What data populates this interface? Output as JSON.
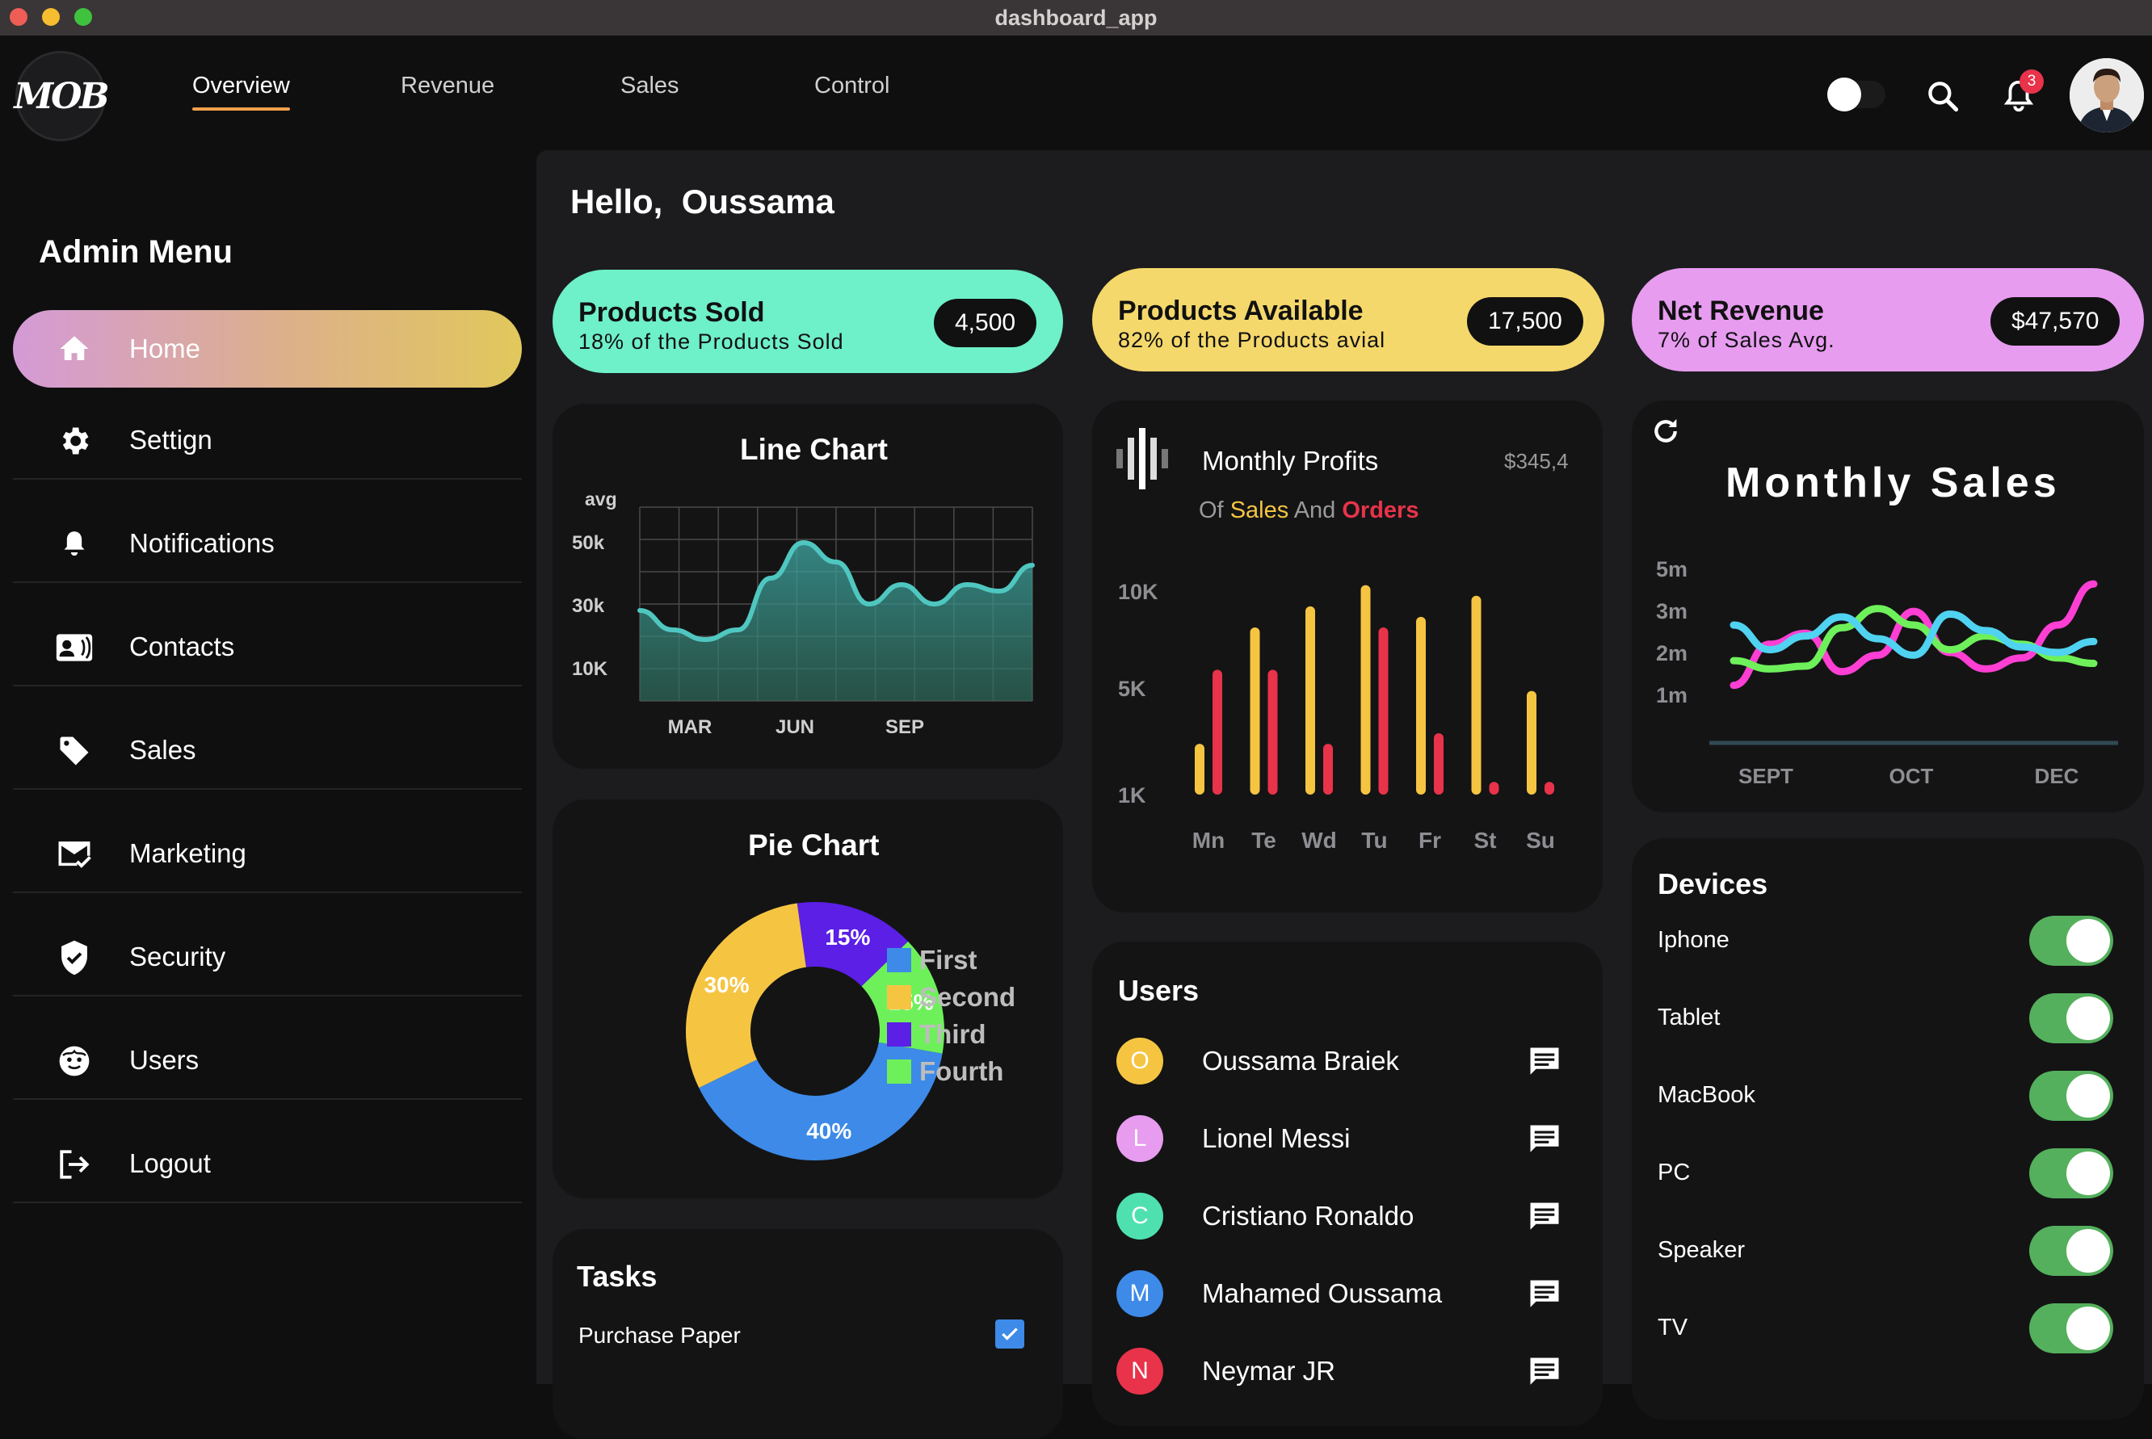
{
  "window": {
    "title": "dashboard_app"
  },
  "brand": {
    "logo_text": "MOB"
  },
  "nav": {
    "tabs": [
      "Overview",
      "Revenue",
      "Sales",
      "Control"
    ],
    "notifications_count": "3"
  },
  "sidebar": {
    "title": "Admin Menu",
    "items": [
      {
        "label": "Home",
        "icon": "home-icon"
      },
      {
        "label": "Settign",
        "icon": "gear-icon"
      },
      {
        "label": "Notifications",
        "icon": "bell-icon"
      },
      {
        "label": "Contacts",
        "icon": "contact-card-icon"
      },
      {
        "label": "Sales",
        "icon": "tag-icon"
      },
      {
        "label": "Marketing",
        "icon": "mail-check-icon"
      },
      {
        "label": "Security",
        "icon": "shield-icon"
      },
      {
        "label": "Users",
        "icon": "face-icon"
      },
      {
        "label": "Logout",
        "icon": "logout-icon"
      }
    ]
  },
  "greeting": {
    "hello": "Hello,",
    "name": "Oussama"
  },
  "stats": [
    {
      "title": "Products Sold",
      "subtitle": "18% of the Products Sold",
      "value": "4,500",
      "color": "#6ef0c8"
    },
    {
      "title": "Products Available",
      "subtitle": "82% of the Products avial",
      "value": "17,500",
      "color": "#f5d86b"
    },
    {
      "title": "Net Revenue",
      "subtitle": "7% of Sales Avg.",
      "value": "$47,570",
      "color": "#e79cf0"
    }
  ],
  "line_chart": {
    "title": "Line Chart"
  },
  "pie_chart": {
    "title": "Pie Chart"
  },
  "profits": {
    "title": "Monthly Profits",
    "amount": "$345,4",
    "subtitle_prefix": "Of",
    "subtitle_sales": "Sales",
    "subtitle_and": "And",
    "subtitle_orders": "Orders"
  },
  "monthly_sales": {
    "title": "Monthly Sales"
  },
  "tasks": {
    "title": "Tasks",
    "items": [
      {
        "label": "Purchase Paper",
        "checked": true
      }
    ]
  },
  "users": {
    "title": "Users",
    "items": [
      {
        "initial": "O",
        "name": "Oussama Braiek",
        "color": "#f5c542"
      },
      {
        "initial": "L",
        "name": "Lionel Messi",
        "color": "#e79cf0"
      },
      {
        "initial": "C",
        "name": "Cristiano Ronaldo",
        "color": "#4fe0b0"
      },
      {
        "initial": "M",
        "name": "Mahamed Oussama",
        "color": "#3d8ae8"
      },
      {
        "initial": "N",
        "name": "Neymar JR",
        "color": "#e8334a"
      }
    ]
  },
  "devices": {
    "title": "Devices",
    "items": [
      {
        "name": "Iphone",
        "on": true
      },
      {
        "name": "Tablet",
        "on": true
      },
      {
        "name": "MacBook",
        "on": true
      },
      {
        "name": "PC",
        "on": true
      },
      {
        "name": "Speaker",
        "on": true
      },
      {
        "name": "TV",
        "on": true
      }
    ]
  },
  "chart_data": [
    {
      "type": "area",
      "title": "Line Chart",
      "ylabel": "avg",
      "yticks": [
        "50k",
        "30k",
        "10K"
      ],
      "xticks": [
        "MAR",
        "JUN",
        "SEP"
      ],
      "x": [
        1,
        2,
        3,
        4,
        5,
        6,
        7,
        8,
        9,
        10,
        11,
        12,
        13
      ],
      "values": [
        28,
        22,
        19,
        22,
        38,
        49,
        43,
        30,
        36,
        30,
        36,
        34,
        42
      ],
      "ylim": [
        0,
        60
      ],
      "grid": true,
      "color": "#4fc7c0"
    },
    {
      "type": "pie",
      "title": "Pie Chart",
      "categories": [
        "First",
        "Second",
        "Third",
        "Fourth"
      ],
      "values": [
        40,
        30,
        15,
        15
      ],
      "labels": [
        "40%",
        "30%",
        "15%",
        "15%"
      ],
      "colors": [
        "#3d8ae8",
        "#f5c542",
        "#5b1fe6",
        "#6ef05a"
      ]
    },
    {
      "type": "bar",
      "title": "Monthly Profits",
      "categories": [
        "Mn",
        "Te",
        "Wd",
        "Tu",
        "Fr",
        "St",
        "Su"
      ],
      "yticks": [
        "10K",
        "5K",
        "1K"
      ],
      "series": [
        {
          "name": "Sales",
          "color": "#f5c542",
          "values": [
            2.4,
            7.9,
            8.9,
            9.9,
            8.4,
            9.4,
            4.9
          ]
        },
        {
          "name": "Orders",
          "color": "#e8334a",
          "values": [
            5.9,
            5.9,
            2.4,
            7.9,
            2.9,
            0.6,
            0.6
          ]
        }
      ],
      "ylim": [
        0,
        10
      ]
    },
    {
      "type": "line",
      "title": "Monthly Sales",
      "yticks": [
        "5m",
        "3m",
        "2m",
        "1m"
      ],
      "xticks": [
        "SEPT",
        "OCT",
        "DEC"
      ],
      "series": [
        {
          "color": "#ff3fd3",
          "values": [
            1.1,
            2.6,
            3.0,
            1.6,
            2.2,
            3.8,
            2.3,
            1.7,
            2.1,
            3.3,
            4.8
          ]
        },
        {
          "color": "#6ef05a",
          "values": [
            2.0,
            1.7,
            1.8,
            3.2,
            3.9,
            3.3,
            2.4,
            2.9,
            2.6,
            2.1,
            1.9
          ]
        },
        {
          "color": "#4fd3f0",
          "values": [
            3.3,
            2.4,
            2.9,
            3.6,
            2.8,
            2.2,
            3.7,
            3.1,
            2.5,
            2.3,
            2.7
          ]
        }
      ],
      "ylim": [
        0,
        5.6
      ]
    }
  ]
}
